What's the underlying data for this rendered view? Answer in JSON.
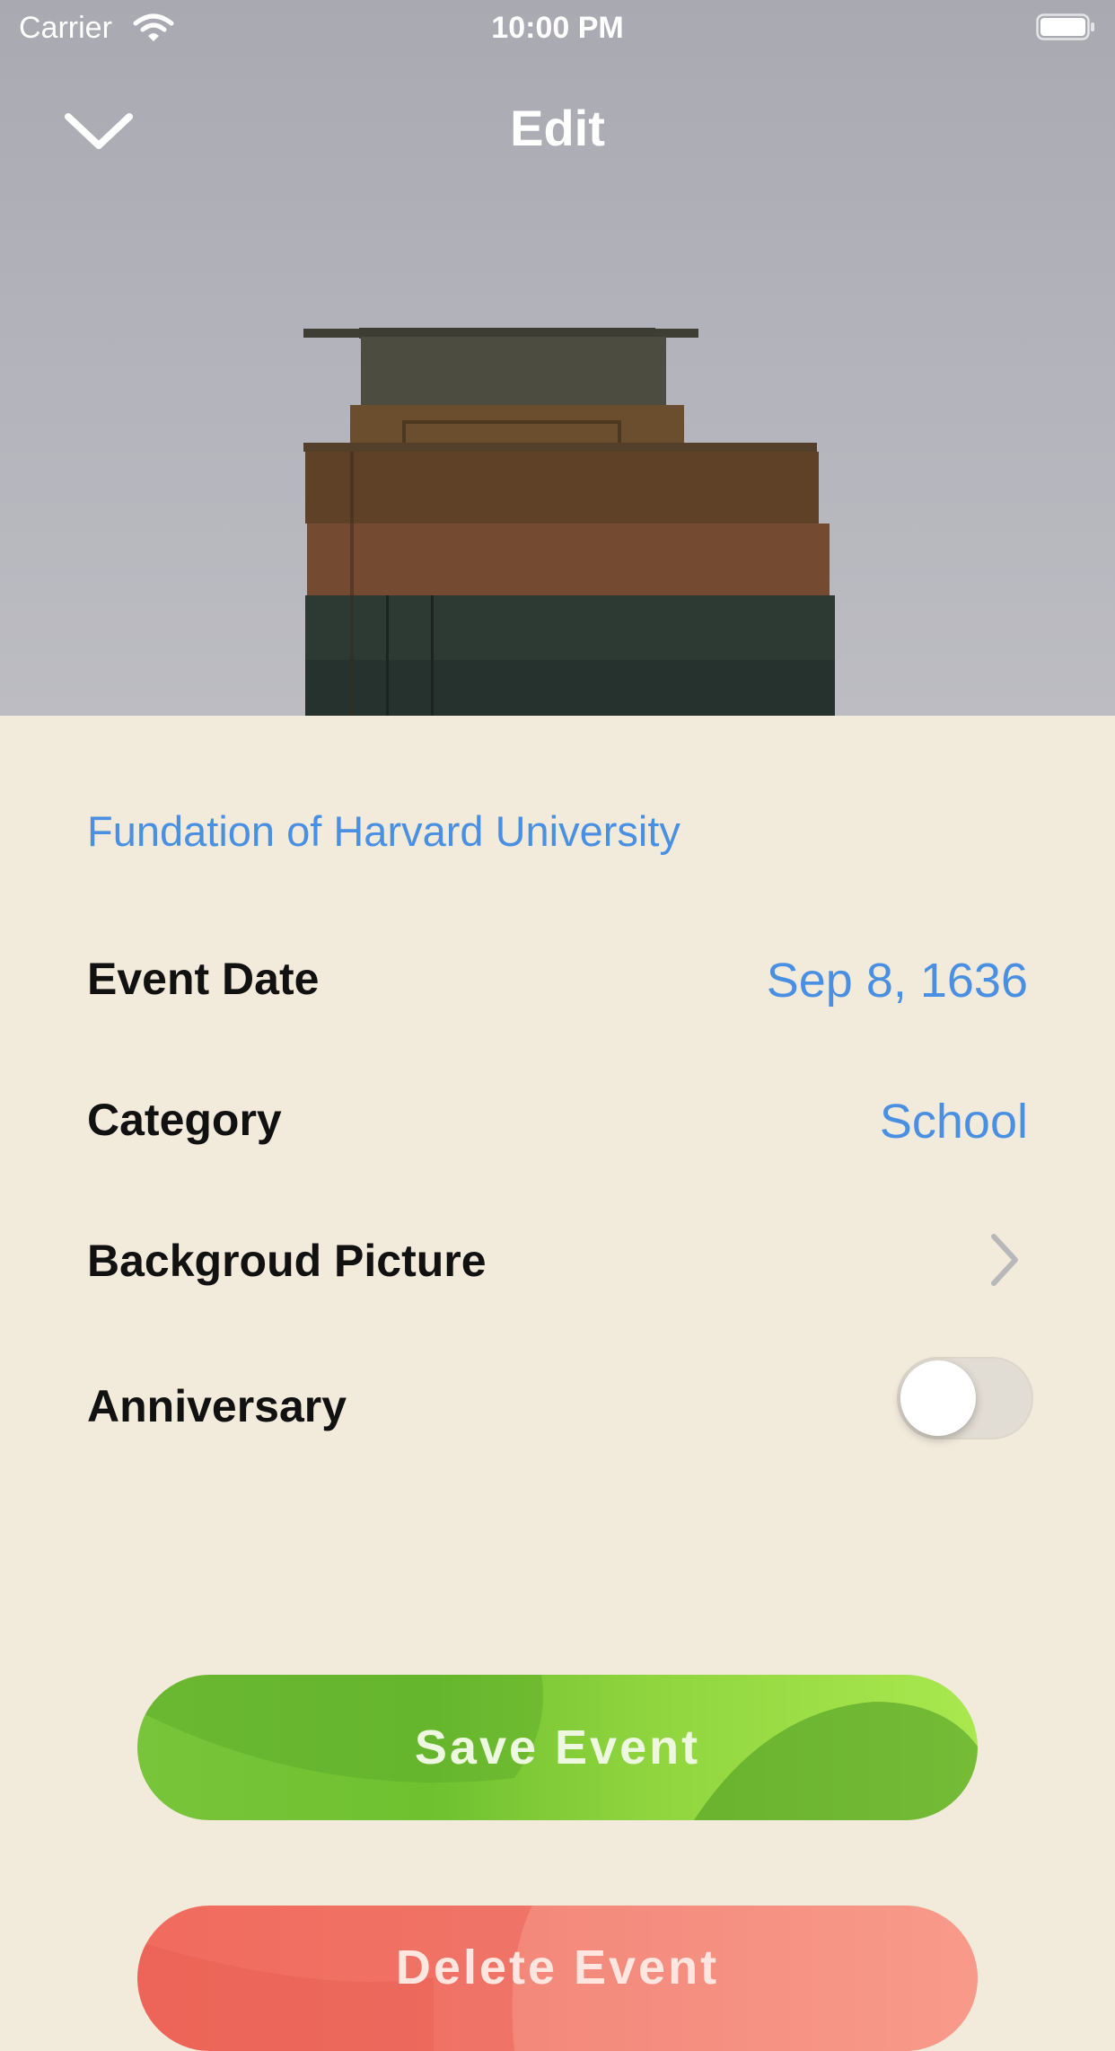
{
  "status_bar": {
    "carrier": "Carrier",
    "time": "10:00 PM"
  },
  "nav": {
    "title": "Edit",
    "back_icon": "chevron-down-icon"
  },
  "hero": {
    "image": "stack-of-vintage-books"
  },
  "event": {
    "title": "Fundation of Harvard University"
  },
  "fields": {
    "event_date": {
      "label": "Event Date",
      "value": "Sep 8, 1636"
    },
    "category": {
      "label": "Category",
      "value": "School"
    },
    "background": {
      "label": "Backgroud Picture",
      "icon": "chevron-right-icon"
    },
    "anniversary": {
      "label": "Anniversary",
      "on": false
    }
  },
  "buttons": {
    "save": "Save Event",
    "delete": "Delete Event"
  },
  "colors": {
    "accent": "#4a90e2",
    "background": "#f2eadb",
    "save": "#6fc130",
    "delete": "#f16b5e"
  }
}
